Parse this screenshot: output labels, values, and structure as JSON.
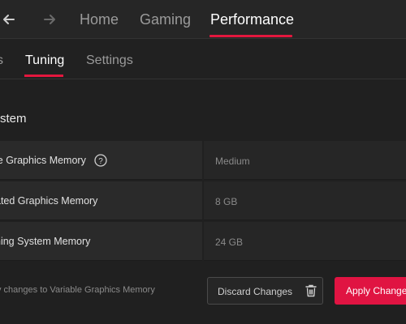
{
  "topnav": {
    "tabs": [
      {
        "label": "Home"
      },
      {
        "label": "Gaming"
      },
      {
        "label": "Performance"
      }
    ],
    "active": "Performance",
    "accent": "#e3173e"
  },
  "subnav": {
    "tabs": [
      {
        "label": "s"
      },
      {
        "label": "Tuning"
      },
      {
        "label": "Settings"
      }
    ],
    "active": "Tuning"
  },
  "section": {
    "title": "stem"
  },
  "rows": [
    {
      "label": "le Graphics Memory",
      "value": "Medium",
      "icon": "help-icon"
    },
    {
      "label": "ated Graphics Memory",
      "value": "8 GB"
    },
    {
      "label": "ning System Memory",
      "value": "24 GB"
    }
  ],
  "footer": {
    "note": "y changes to Variable Graphics Memory",
    "discard_label": "Discard Changes",
    "discard_icon": "trash-icon",
    "apply_label": "Apply Changes",
    "apply_color": "#e01442"
  }
}
